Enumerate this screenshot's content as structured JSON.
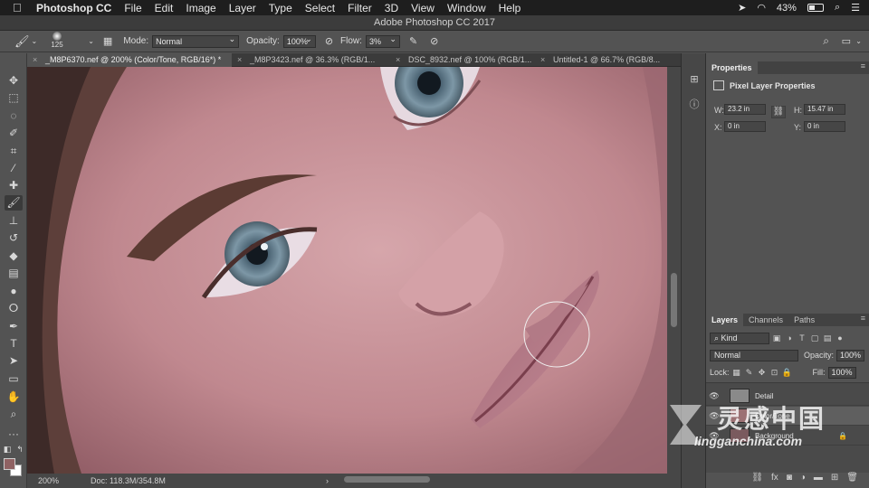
{
  "menubar": {
    "app_name": "Photoshop CC",
    "items": [
      "File",
      "Edit",
      "Image",
      "Layer",
      "Type",
      "Select",
      "Filter",
      "3D",
      "View",
      "Window",
      "Help"
    ],
    "battery": "43%"
  },
  "window_title": "Adobe Photoshop CC 2017",
  "options": {
    "brush_size": "125",
    "mode_label": "Mode:",
    "mode_value": "Normal",
    "opacity_label": "Opacity:",
    "opacity_value": "100%",
    "flow_label": "Flow:",
    "flow_value": "3%"
  },
  "tabs": [
    {
      "label": "_M8P6370.nef @ 200% (Color/Tone, RGB/16*) *"
    },
    {
      "label": "_M8P3423.nef @ 36.3% (RGB/1..."
    },
    {
      "label": "DSC_8932.nef @ 100% (RGB/1..."
    },
    {
      "label": "Untitled-1 @ 66.7% (RGB/8..."
    }
  ],
  "status": {
    "zoom": "200%",
    "doc": "Doc: 118.3M/354.8M"
  },
  "properties": {
    "tab": "Properties",
    "header": "Pixel Layer Properties",
    "w_label": "W:",
    "w_value": "23.2 in",
    "h_label": "H:",
    "h_value": "15.47 in",
    "x_label": "X:",
    "x_value": "0 in",
    "y_label": "Y:",
    "y_value": "0 in"
  },
  "layers_panel": {
    "tabs": [
      "Layers",
      "Channels",
      "Paths"
    ],
    "filter": "Kind",
    "blend_mode": "Normal",
    "opacity_label": "Opacity:",
    "opacity_value": "100%",
    "lock_label": "Lock:",
    "fill_label": "Fill:",
    "fill_value": "100%",
    "layers": [
      {
        "name": "Detail",
        "color": "#8a8a8a"
      },
      {
        "name": "Color/Tone",
        "color": "#9c7174"
      },
      {
        "name": "Background",
        "color": "#7a5a5e"
      }
    ]
  },
  "watermark": {
    "cn": "灵感中国",
    "site": "lingganchina.com"
  },
  "colors": {
    "foreground": "#8f6263",
    "background": "#ffffff"
  }
}
